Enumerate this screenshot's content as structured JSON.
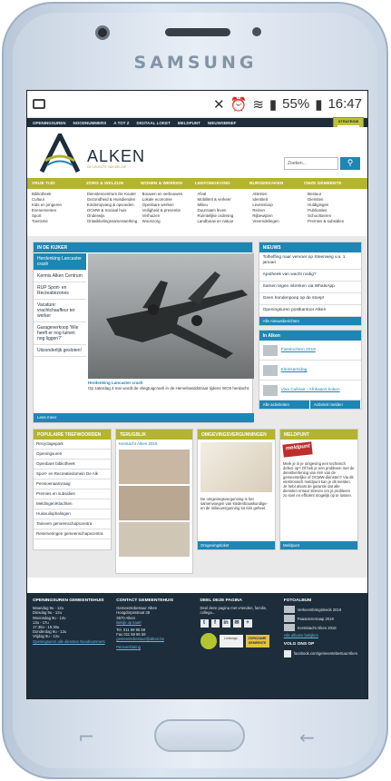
{
  "device": {
    "brand": "SAMSUNG"
  },
  "status_bar": {
    "signal": "55%",
    "time": "16:47"
  },
  "topbar": {
    "items": [
      "OPENINGSUREN",
      "NOODNUMMERS",
      "A TOT Z",
      "DIGITAAL LOKET",
      "MELDPUNT",
      "NIEUWSBRIEF"
    ]
  },
  "strategy": {
    "label": "STRATEGIE"
  },
  "header": {
    "logo_text": "ALKEN",
    "logo_sub": "DE LEUKSTE VAN BELGIË",
    "search_placeholder": "Zoeken..."
  },
  "menu": {
    "sections": [
      "VRIJE TIJD",
      "ZORG & WELZIJN",
      "WONEN & WERKEN",
      "LEEFOMGEVING",
      "BURGERZAKEN",
      "ONZE GEMEENTE"
    ],
    "columns": [
      [
        "Bibliotheek",
        "Cultuur",
        "Kids en jongeren",
        "Evenementen",
        "Sport",
        "Toerisme"
      ],
      [
        "Dienstencentrum De Kouter",
        "Gezondheid & Huisdienden",
        "Kinderopvang & opvoeden",
        "OCMW & Sociaal huis",
        "Onderwijs",
        "Ontwikkelingssamenwerking"
      ],
      [
        "Bouwen en verbouwen",
        "Lokale economie",
        "Openbare werken",
        "Veiligheid & preventie",
        "Verhuizen",
        "Woonzorg"
      ],
      [
        "Afval",
        "Mobiliteit & verkeer",
        "Milieu",
        "Duurzaam leven",
        "Ruimtelijke ordening",
        "Landbouw en natuur"
      ],
      [
        "Attesten",
        "Identiteit",
        "Levensloop",
        "Reizen",
        "Rijbewijzen",
        "Vreemdelingen"
      ],
      [
        "Bestuur",
        "Diensten",
        "Huldigingen",
        "Publicaties",
        "Schooltoeren",
        "Premies & subsidies"
      ]
    ]
  },
  "kijker": {
    "title": "IN DE KIJKER",
    "items": [
      "Herdenking Lancaster crash",
      "Kermis Alken Centrum",
      "RUP Sport- en Recreatiezones",
      "Vacature: vrachtchauffeur ter werker",
      "Garageverkoop 'Wie heeft er nog tuinen nog liggen?'",
      "Uitzonderlijk gesloten!"
    ],
    "caption_title": "Herdenking Lancaster crash",
    "caption_text": "Op zaterdag 4 mei wordt de vliegtuigcrash in de Hemelswiddstraat tijdens WOII herdacht.",
    "footer": "Lees meer"
  },
  "nieuws": {
    "title": "NIEUWS",
    "items": [
      "Tolheffing naar vervoer op Steenweg v.a. 1 januari",
      "Apotheek van wacht nodig?",
      "Samen tegen inbreken via WhatsApp",
      "Geen hondenpoep op de stoep!",
      "Openingsuren postkantoor Alken"
    ],
    "footer": "Alle nieuwsberichten"
  },
  "in_alken": {
    "title": "In Alken",
    "items": [
      "Fietstochten 2019",
      "Kleinsamidag",
      "Viva Culinair - Afrikaans koken"
    ],
    "footer_left": "Alle activiteiten",
    "footer_right": "Activiteit melden"
  },
  "trefwoorden": {
    "title": "POPULAIRE TREFWOORDEN",
    "items": [
      "Recyclagepark",
      "Openingsuren",
      "Openbare bibliotheek",
      "Sport- en Recreatiedomein De Alk",
      "Pensioenaanvraag",
      "Premies en subsidies",
      "Meldingen/Klachten",
      "Huisvuilophalingen",
      "Tarieven gemeenschapscentra",
      "Reserveringen gemeenschapscentra"
    ]
  },
  "terugblik": {
    "title": "TERUGBLIK",
    "item": "Kerstacht Alken 2018"
  },
  "omgevings": {
    "title": "OMGEVINGSVERGUNNINGEN",
    "text": "De omgevingsvergunning is het samenvoegen van stedenbouwkundige- en de milieuvergunning tot één geheel.",
    "footer": "Omgevingsloket"
  },
  "meldpunt": {
    "title": "MELDPUNT",
    "logo": "meldpunt",
    "text": "Merk je in je omgeving een technisch defect op? Of heb je een probleem met de dienstverlening van één van de gemeentelijke of OCMW-diensten? Via dit elektronisch meldpunt kan je dit melden. Je hebt alvast de garantie dat alle diensten ernaar streven om je probleem zo snel en efficiënt mogelijk op te lossen.",
    "footer": "Meldpunt"
  },
  "footer": {
    "hours": {
      "title": "OPENINGSUREN GEMEENTEHUIS",
      "lines": [
        "Maandag 9u - 12u",
        "Dinsdag 9u - 12u",
        "Woensdag 9u - 12u",
        "13u - 17u",
        "17.30u - 19.30u",
        "Donderdag 9u - 12u",
        "Vrijdag 9u - 12u"
      ],
      "link": "Openingsuren alle diensten Noodnummers"
    },
    "contact": {
      "title": "CONTACT GEMEENTEHUIS",
      "lines": [
        "Gemeentebestuur Alken",
        "Hoogdorpsstraat 38",
        "3570 Alken"
      ],
      "route": "Bekijk op kaart",
      "tel": "Tel. 011 59 95 59",
      "fax": "Fax 011 59 95 58",
      "email": "gemeentebestuur@alken.be",
      "perslink": "Persverklaring"
    },
    "share": {
      "title": "DEEL DEZE PAGINA",
      "text": "Deel deze pagina met vrienden, familie, collega...",
      "icons": [
        "t",
        "f",
        "in",
        "✉",
        "+"
      ],
      "badges": [
        "Kempisch",
        "Limburgs",
        "ZORGZAME GEMEENTE"
      ]
    },
    "album": {
      "title": "FOTOALBUM",
      "items": [
        "Verkeersbringsleeds 2019",
        "Paaseierenraap 2019",
        "Kerststacht Alken 2018"
      ],
      "more": "Alle albums bekijken",
      "follow_title": "VOLG ONS OP",
      "facebook": "facebook.com/gemeentebestuurAlken"
    }
  }
}
